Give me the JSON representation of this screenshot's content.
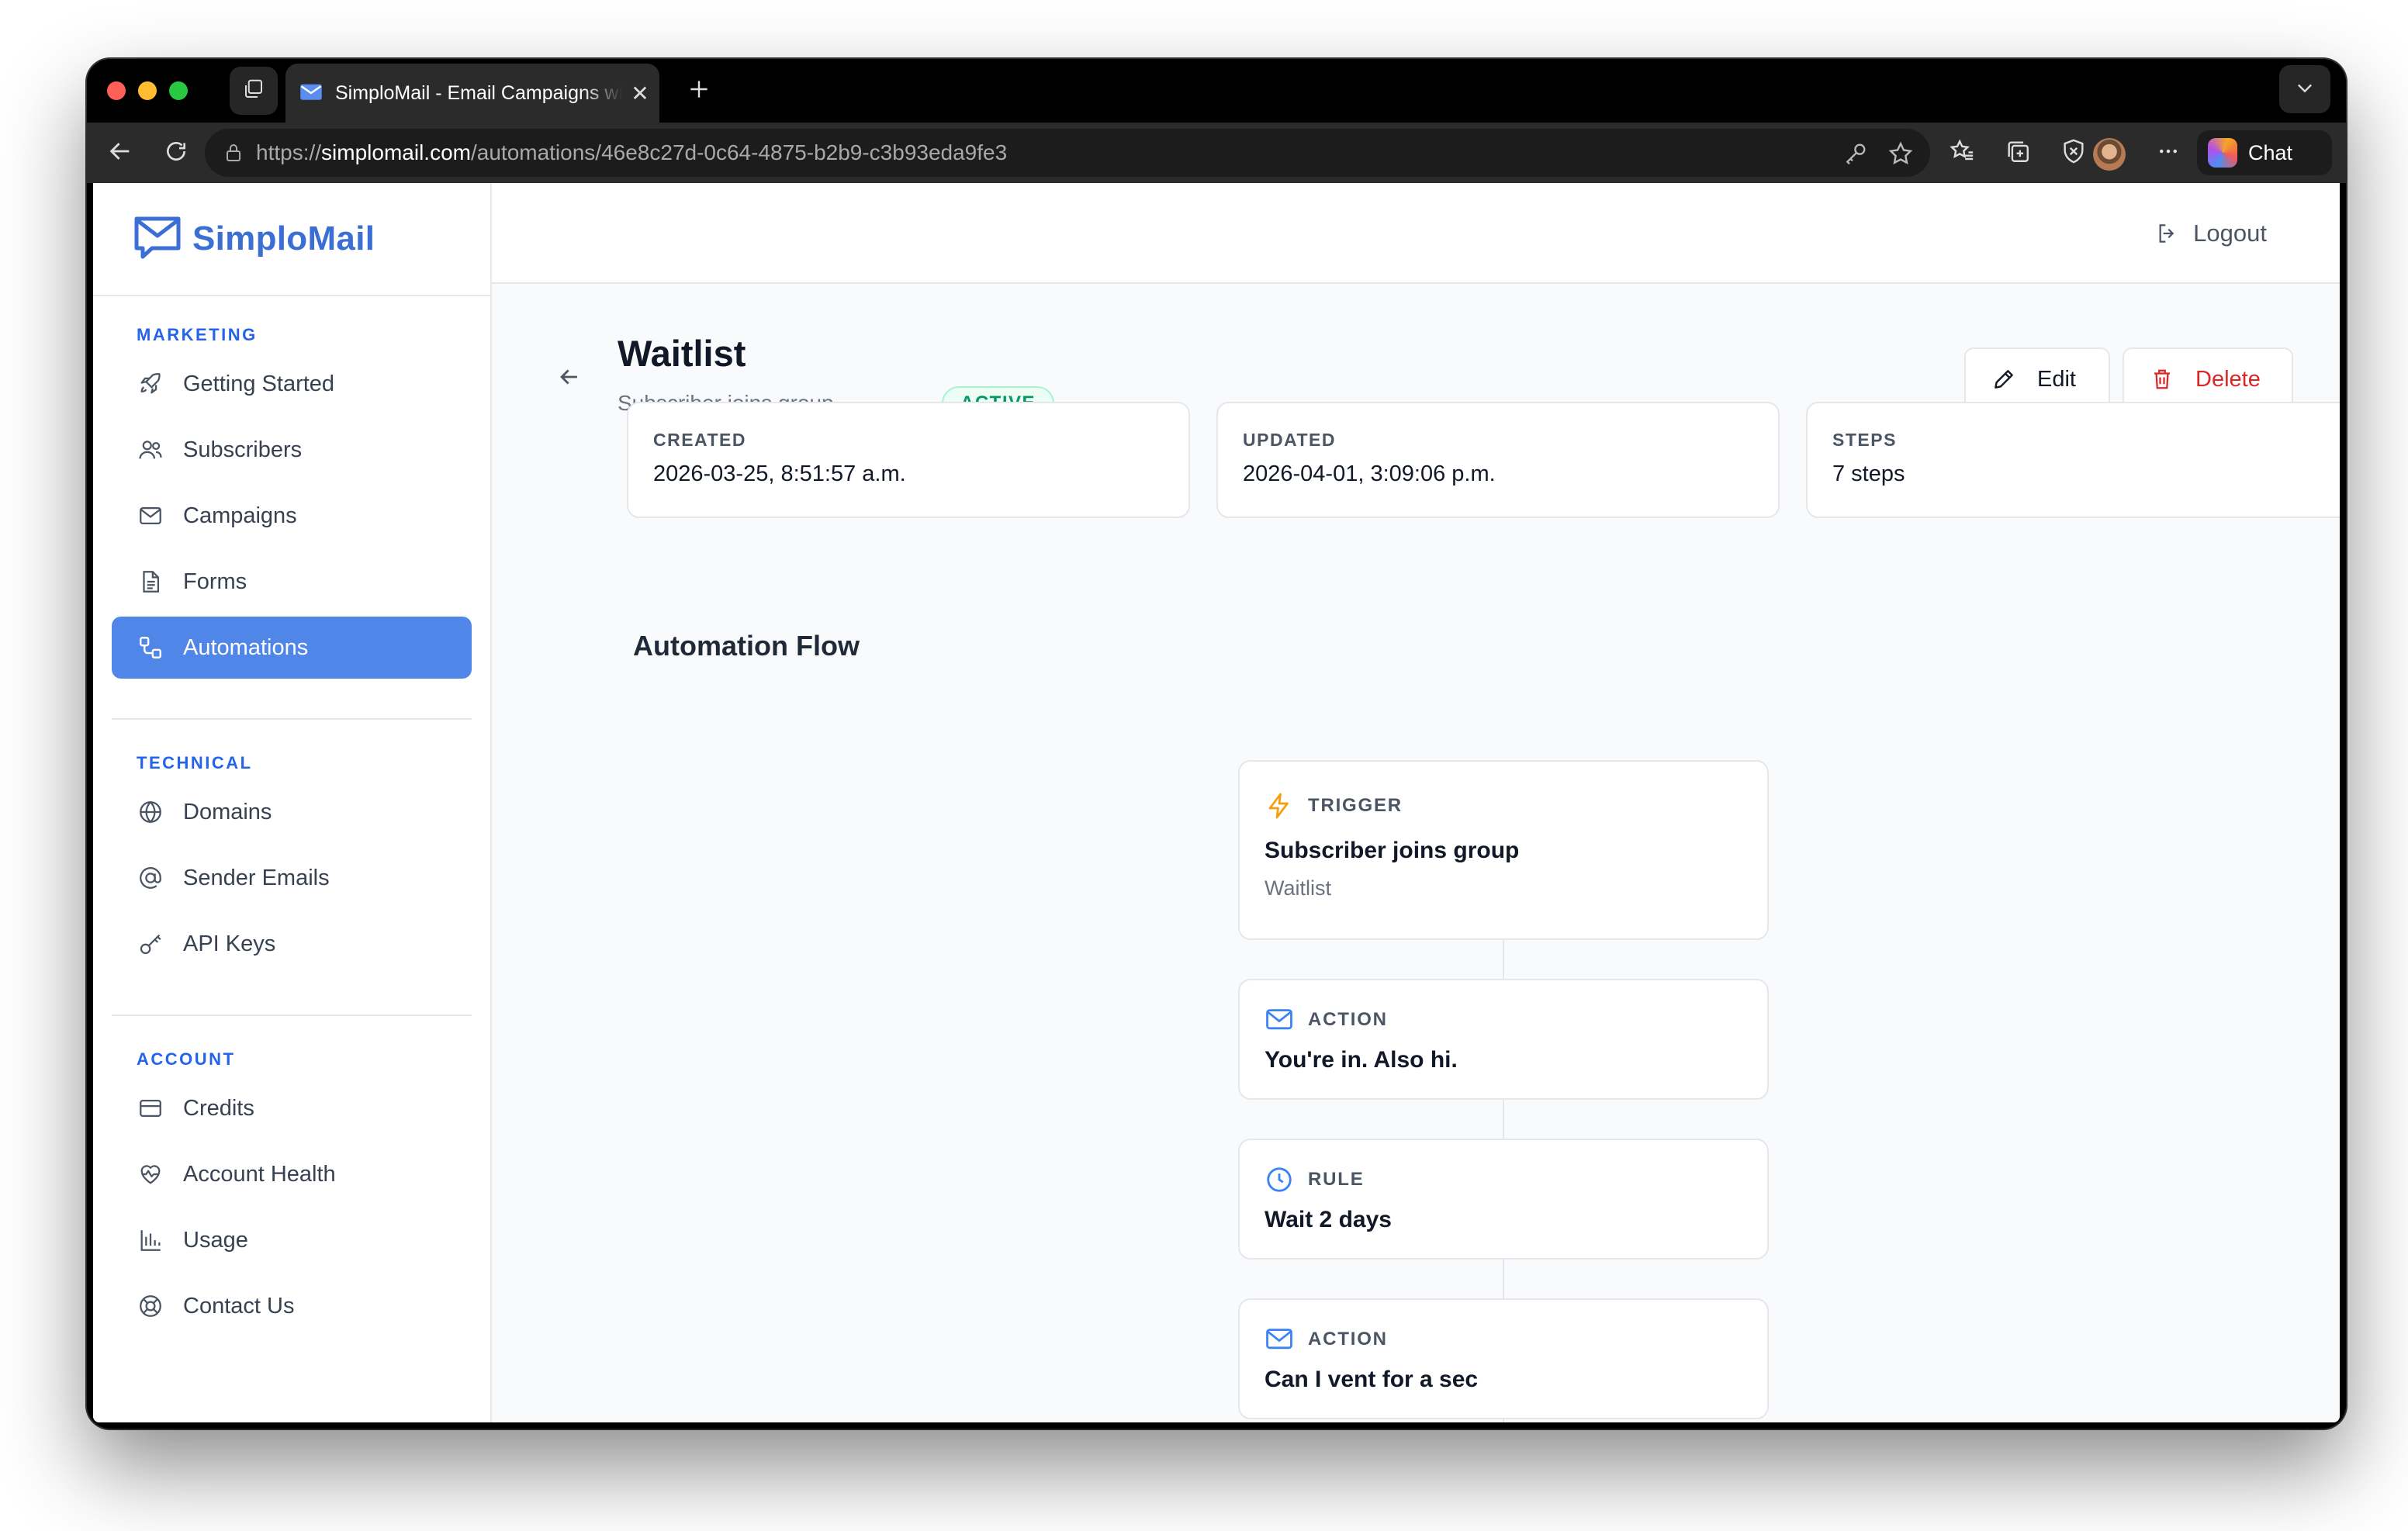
{
  "browser": {
    "tab_title": "SimploMail - Email Campaigns with Automations",
    "url_scheme": "https://",
    "url_host": "simplomail.com",
    "url_path": "/automations/46e8c27d-0c64-4875-b2b9-c3b93eda9fe3",
    "chat_label": "Chat"
  },
  "brand": {
    "name": "SimploMail",
    "color": "#3b6fd4"
  },
  "sidebar": {
    "sections": [
      {
        "label": "MARKETING",
        "items": [
          {
            "label": "Getting Started",
            "icon": "rocket-icon"
          },
          {
            "label": "Subscribers",
            "icon": "users-icon"
          },
          {
            "label": "Campaigns",
            "icon": "mail-icon"
          },
          {
            "label": "Forms",
            "icon": "document-icon"
          },
          {
            "label": "Automations",
            "icon": "automation-icon",
            "active": true
          }
        ]
      },
      {
        "label": "TECHNICAL",
        "items": [
          {
            "label": "Domains",
            "icon": "globe-icon"
          },
          {
            "label": "Sender Emails",
            "icon": "at-icon"
          },
          {
            "label": "API Keys",
            "icon": "key-icon"
          }
        ]
      },
      {
        "label": "ACCOUNT",
        "items": [
          {
            "label": "Credits",
            "icon": "credit-card-icon"
          },
          {
            "label": "Account Health",
            "icon": "heart-pulse-icon"
          },
          {
            "label": "Usage",
            "icon": "bar-chart-icon"
          },
          {
            "label": "Contact Us",
            "icon": "lifebuoy-icon"
          }
        ]
      }
    ]
  },
  "topbar": {
    "logout_label": "Logout"
  },
  "automation": {
    "title": "Waitlist",
    "trigger_summary": "Subscriber joins group",
    "status": "ACTIVE",
    "edit_label": "Edit",
    "delete_label": "Delete",
    "stats": [
      {
        "label": "CREATED",
        "value": "2026-03-25, 8:51:57 a.m."
      },
      {
        "label": "UPDATED",
        "value": "2026-04-01, 3:09:06 p.m."
      },
      {
        "label": "STEPS",
        "value": "7 steps"
      }
    ]
  },
  "flow": {
    "heading": "Automation Flow",
    "steps": [
      {
        "kind": "TRIGGER",
        "icon": "bolt-icon",
        "title": "Subscriber joins group",
        "subtitle": "Waitlist"
      },
      {
        "kind": "ACTION",
        "icon": "mail-icon",
        "title": "You're in. Also hi."
      },
      {
        "kind": "RULE",
        "icon": "clock-icon",
        "title": "Wait 2 days"
      },
      {
        "kind": "ACTION",
        "icon": "mail-icon",
        "title": "Can I vent for a sec"
      }
    ]
  },
  "colors": {
    "accent": "#4f86e8",
    "active_badge": "#059669",
    "danger": "#dc2626",
    "trigger_icon": "#f59e0b",
    "action_icon": "#3b82f6"
  }
}
